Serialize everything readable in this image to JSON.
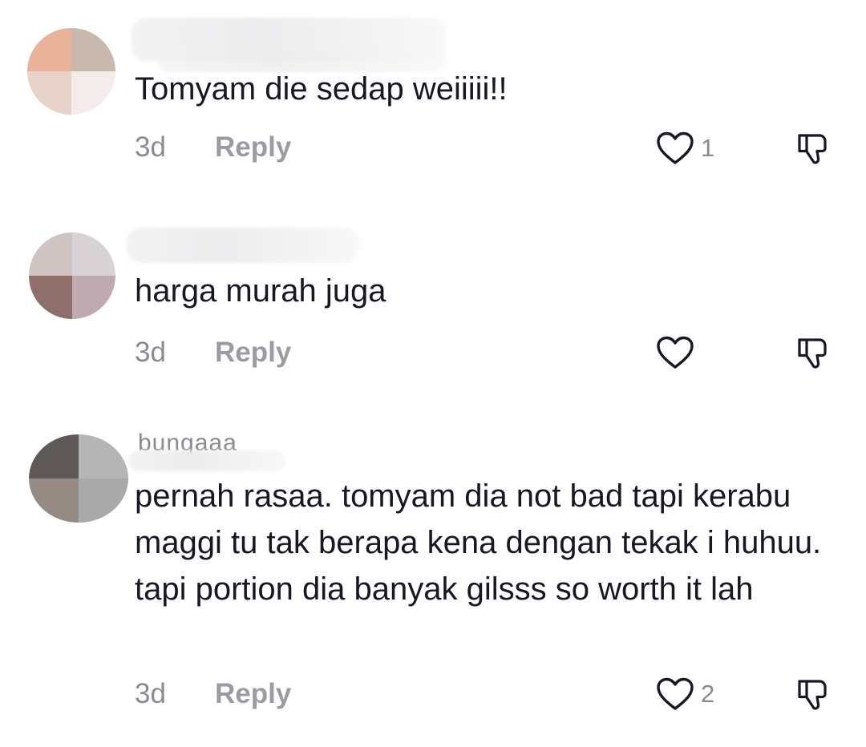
{
  "comments": [
    {
      "text": "Tomyam die sedap weiiiii!!",
      "age": "3d",
      "reply_label": "Reply",
      "likes": "1",
      "avatar_colors": [
        "#e9b29b",
        "#c9b8ae",
        "#e8d3ca",
        "#ffffff"
      ]
    },
    {
      "text": "harga murah juga",
      "age": "3d",
      "reply_label": "Reply",
      "likes": "",
      "avatar_colors": [
        "#cfc4c2",
        "#d9d2d4",
        "#8e6f6c",
        "#c0aab2"
      ]
    },
    {
      "username": "bungaaa",
      "text": "pernah rasaa. tomyam dia not bad tapi kerabu maggi tu tak berapa kena dengan tekak i huhuu. tapi portion dia banyak gilsss so worth it lah",
      "age": "3d",
      "reply_label": "Reply",
      "likes": "2",
      "avatar_colors": [
        "#5e5856",
        "#b5b5b5",
        "#968a84",
        "#a9a9a9"
      ]
    }
  ],
  "icons": {
    "like": "heart-outline-icon",
    "dislike": "thumbs-down-outline-icon"
  },
  "colors": {
    "text": "#161823",
    "muted": "#8a8b91"
  }
}
